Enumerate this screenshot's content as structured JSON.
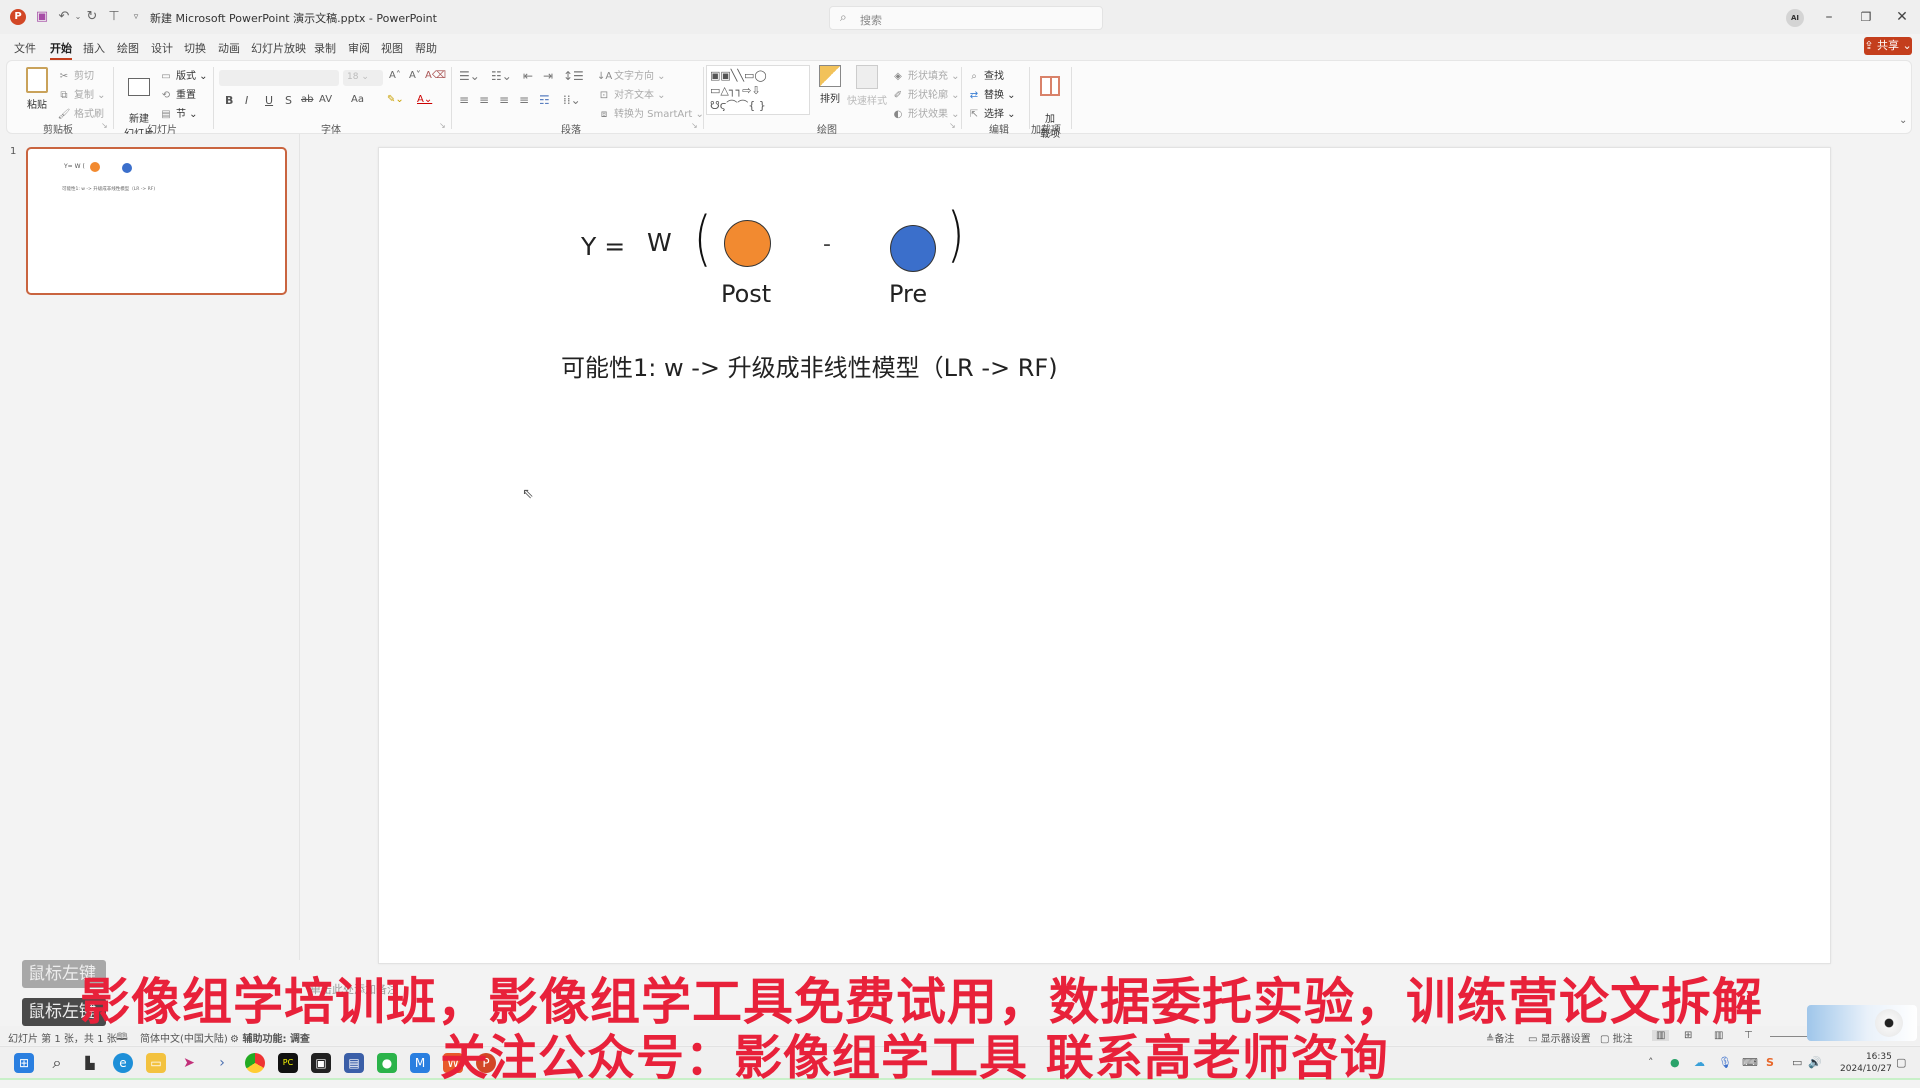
{
  "titlebar": {
    "doc_title": "新建 Microsoft PowerPoint 演示文稿.pptx  -  PowerPoint",
    "search_placeholder": "搜索",
    "ai_label": "AI",
    "icons": [
      "powerpoint-logo",
      "save-icon",
      "undo-icon",
      "redo-icon",
      "present-icon",
      "customize-qat-icon"
    ]
  },
  "tabs": [
    {
      "label": "文件",
      "active": false
    },
    {
      "label": "开始",
      "active": true
    },
    {
      "label": "插入",
      "active": false
    },
    {
      "label": "绘图",
      "active": false
    },
    {
      "label": "设计",
      "active": false
    },
    {
      "label": "切换",
      "active": false
    },
    {
      "label": "动画",
      "active": false
    },
    {
      "label": "幻灯片放映",
      "active": false
    },
    {
      "label": "录制",
      "active": false
    },
    {
      "label": "审阅",
      "active": false
    },
    {
      "label": "视图",
      "active": false
    },
    {
      "label": "帮助",
      "active": false
    }
  ],
  "share": {
    "label": "共享"
  },
  "ribbon": {
    "clipboard": {
      "label": "剪贴板",
      "paste": "粘贴",
      "cut": "剪切",
      "copy": "复制",
      "format_painter": "格式刷"
    },
    "slides": {
      "label": "幻灯片",
      "new_slide": "新建\n幻灯片",
      "layout": "版式",
      "reset": "重置",
      "section": "节"
    },
    "font": {
      "label": "字体",
      "font_name": "",
      "font_size": "18",
      "buttons": [
        "B",
        "I",
        "U",
        "S",
        "ab",
        "AV",
        "Aa"
      ]
    },
    "paragraph": {
      "label": "段落",
      "text_direction": "文字方向",
      "align_text": "对齐文本",
      "smartart": "转换为 SmartArt"
    },
    "drawing": {
      "label": "绘图",
      "arrange": "排列",
      "quick_styles": "快速样式",
      "shape_fill": "形状填充",
      "shape_outline": "形状轮廓",
      "shape_effects": "形状效果"
    },
    "editing": {
      "label": "编辑",
      "find": "查找",
      "replace": "替换",
      "select": "选择"
    },
    "addins": {
      "label": "加载项",
      "addins_button": "加\n载项"
    }
  },
  "thumbnails": [
    {
      "number": "1",
      "selected": true
    }
  ],
  "slide": {
    "equation": {
      "y_eq": "Y =",
      "w": "W",
      "open_paren": "(",
      "minus": "-",
      "close_paren": ")",
      "post_label": "Post",
      "pre_label": "Pre",
      "post_color": "#f28a30",
      "pre_color": "#3b6fcb"
    },
    "note_line": "可能性1:   w -> 升级成非线性模型（LR -> RF)"
  },
  "notes_hint": "单击此处添加备注",
  "mouse_overlays": [
    "鼠标左键",
    "鼠标左键"
  ],
  "statusbar": {
    "slide_count": "幻灯片 第 1 张，共 1 张",
    "language": "简体中文(中国大陆)",
    "accessibility": "辅助功能: 调查",
    "notes": "备注",
    "display_settings": "显示器设置",
    "comments": "批注"
  },
  "taskbar": {
    "apps": [
      "start",
      "search",
      "task-view",
      "edge",
      "file-explorer",
      "feishu",
      "terminal",
      "chrome",
      "pycharm",
      "video-app",
      "remote-desktop",
      "wechat",
      "tencent-meeting",
      "wps",
      "powerpoint"
    ],
    "time": "16:35",
    "date": "2024/10/27"
  },
  "captions": {
    "line1": "影像组学培训班，影像组学工具免费试用，数据委托实验，训练营论文拆解",
    "line2": "关注公众号：影像组学工具   联系高老师咨询"
  },
  "colors": {
    "accent": "#c43e1c",
    "caption": "#e8213a"
  }
}
